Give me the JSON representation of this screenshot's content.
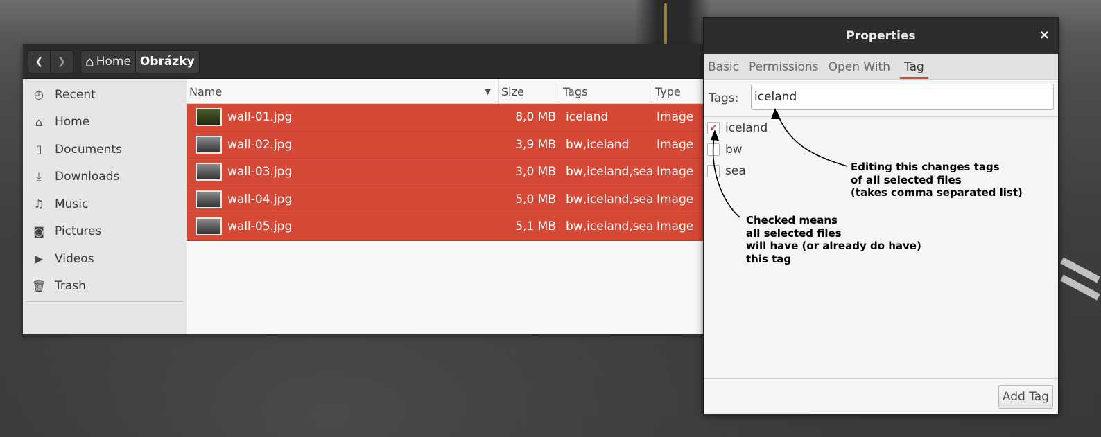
{
  "file_manager": {
    "nav": {
      "back_icon": "chevron-left-icon",
      "forward_icon": "chevron-right-icon"
    },
    "breadcrumb": {
      "home": "Home",
      "current": "Obrázky"
    },
    "sidebar": {
      "items": [
        {
          "label": "Recent",
          "icon": "clock-icon",
          "glyph": "◴"
        },
        {
          "label": "Home",
          "icon": "home-icon",
          "glyph": "⌂"
        },
        {
          "label": "Documents",
          "icon": "document-icon",
          "glyph": "▯"
        },
        {
          "label": "Downloads",
          "icon": "download-icon",
          "glyph": "⤓"
        },
        {
          "label": "Music",
          "icon": "music-icon",
          "glyph": "♫"
        },
        {
          "label": "Pictures",
          "icon": "camera-icon",
          "glyph": "◙"
        },
        {
          "label": "Videos",
          "icon": "video-icon",
          "glyph": "▶"
        },
        {
          "label": "Trash",
          "icon": "trash-icon",
          "glyph": "🗑"
        }
      ]
    },
    "columns": {
      "name": "Name",
      "size": "Size",
      "tags": "Tags",
      "type": "Type"
    },
    "files": [
      {
        "name": "wall-01.jpg",
        "size": "8,0 MB",
        "tags": "iceland",
        "type": "Image"
      },
      {
        "name": "wall-02.jpg",
        "size": "3,9 MB",
        "tags": "bw,iceland",
        "type": "Image"
      },
      {
        "name": "wall-03.jpg",
        "size": "3,0 MB",
        "tags": "bw,iceland,sea",
        "type": "Image"
      },
      {
        "name": "wall-04.jpg",
        "size": "5,0 MB",
        "tags": "bw,iceland,sea",
        "type": "Image"
      },
      {
        "name": "wall-05.jpg",
        "size": "5,1 MB",
        "tags": "bw,iceland,sea",
        "type": "Image"
      }
    ]
  },
  "properties": {
    "title": "Properties",
    "close": "×",
    "tabs": [
      "Basic",
      "Permissions",
      "Open With",
      "Tag"
    ],
    "active_tab": "Tag",
    "tags_label": "Tags:",
    "tags_value": "iceland",
    "tag_list": [
      {
        "label": "iceland",
        "checked": true
      },
      {
        "label": "bw",
        "checked": false
      },
      {
        "label": "sea",
        "checked": false
      }
    ],
    "add_tag": "Add Tag"
  },
  "annotations": {
    "editing": "Editing this changes tags\nof all selected files\n(takes comma separated list)",
    "checked": "Checked means\nall selected files\nwill have (or already do have)\nthis tag"
  },
  "colors": {
    "selection": "#d64937",
    "header": "#2b2b2b"
  }
}
